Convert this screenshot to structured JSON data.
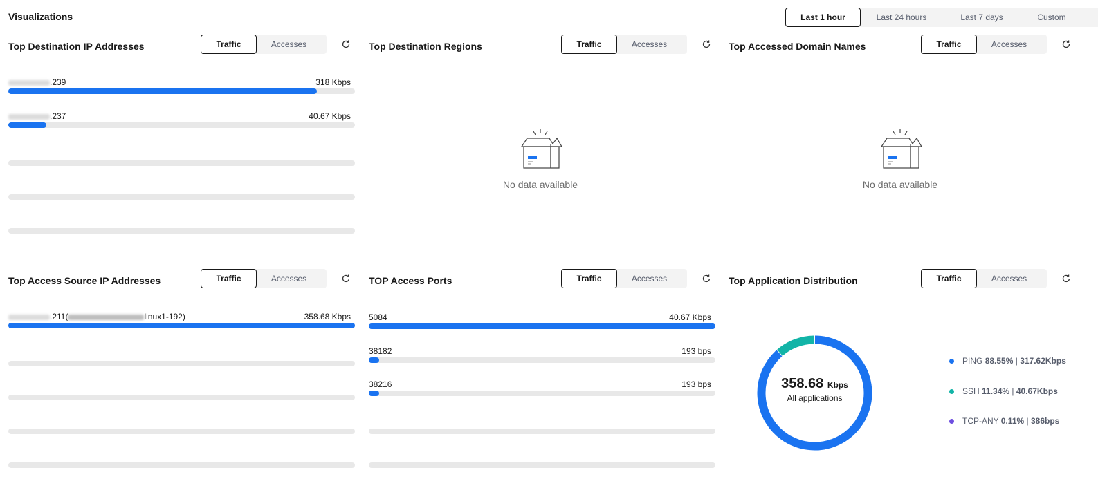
{
  "page_title": "Visualizations",
  "time_range": {
    "options": [
      "Last 1 hour",
      "Last 24 hours",
      "Last 7 days",
      "Custom"
    ],
    "selected": "Last 1 hour"
  },
  "segment": {
    "traffic": "Traffic",
    "accesses": "Accesses"
  },
  "panels": {
    "dest_ip": {
      "title": "Top Destination IP Addresses",
      "rows": [
        {
          "label_suffix": ".239",
          "value": "318 Kbps",
          "fill_fraction": 0.89
        },
        {
          "label_suffix": ".237",
          "value": "40.67 Kbps",
          "fill_fraction": 0.11
        }
      ]
    },
    "dest_regions": {
      "title": "Top Destination Regions",
      "empty_text": "No data available"
    },
    "domains": {
      "title": "Top Accessed Domain Names",
      "empty_text": "No data available"
    },
    "source_ip": {
      "title": "Top Access Source IP Addresses",
      "rows": [
        {
          "label_prefix": ".211(",
          "label_suffix": "linux1-192)",
          "value": "358.68 Kbps",
          "fill_fraction": 1.0
        }
      ]
    },
    "ports": {
      "title": "TOP Access Ports",
      "rows": [
        {
          "label": "5084",
          "value": "40.67 Kbps",
          "fill_fraction": 1.0
        },
        {
          "label": "38182",
          "value": "193 bps",
          "fill_fraction": 0.03
        },
        {
          "label": "38216",
          "value": "193 bps",
          "fill_fraction": 0.03
        }
      ]
    },
    "apps": {
      "title": "Top Application Distribution",
      "center_value": "358.68",
      "center_unit": "Kbps",
      "center_label": "All applications",
      "legend": [
        {
          "name": "PING",
          "percent": "88.55%",
          "amount": "317.62Kbps",
          "fraction": 0.8855,
          "color": "#1a73f0"
        },
        {
          "name": "SSH",
          "percent": "11.34%",
          "amount": "40.67Kbps",
          "fraction": 0.1134,
          "color": "#12b4a7"
        },
        {
          "name": "TCP-ANY",
          "percent": "0.11%",
          "amount": "386bps",
          "fraction": 0.0011,
          "color": "#6e4fe0"
        }
      ]
    }
  },
  "colors": {
    "accent": "#1a73f0",
    "track": "#e8e8e8"
  },
  "icons": {
    "refresh": "refresh-icon",
    "empty": "empty-box-icon"
  }
}
